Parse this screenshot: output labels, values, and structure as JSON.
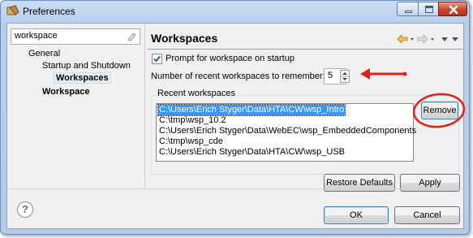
{
  "window": {
    "title": "Preferences"
  },
  "sidebar": {
    "filter_value": "workspace",
    "items": [
      {
        "label": "General"
      },
      {
        "label": "Startup and Shutdown"
      },
      {
        "label": "Workspaces"
      },
      {
        "label": "Workspace"
      }
    ]
  },
  "page": {
    "title": "Workspaces",
    "prompt_label": "Prompt for workspace on startup",
    "prompt_checked": true,
    "recent_count_label": "Number of recent workspaces to remember:",
    "recent_count_value": "5",
    "recent_group_label": "Recent workspaces",
    "recent_workspaces": [
      "C:\\Users\\Erich Styger\\Data\\HTA\\CW\\wsp_Intro",
      "C:\\tmp\\wsp_10.2",
      "C:\\Users\\Erich Styger\\Data\\WebEC\\wsp_EmbeddedComponents",
      "C:\\tmp\\wsp_cde",
      "C:\\Users\\Erich Styger\\Data\\HTA\\CW\\wsp_USB"
    ],
    "remove_label": "Remove",
    "restore_defaults_label": "Restore Defaults",
    "apply_label": "Apply"
  },
  "footer": {
    "help_glyph": "?",
    "ok_label": "OK",
    "cancel_label": "Cancel"
  },
  "colors": {
    "annotation": "#e0201a",
    "selection": "#3399ff"
  }
}
